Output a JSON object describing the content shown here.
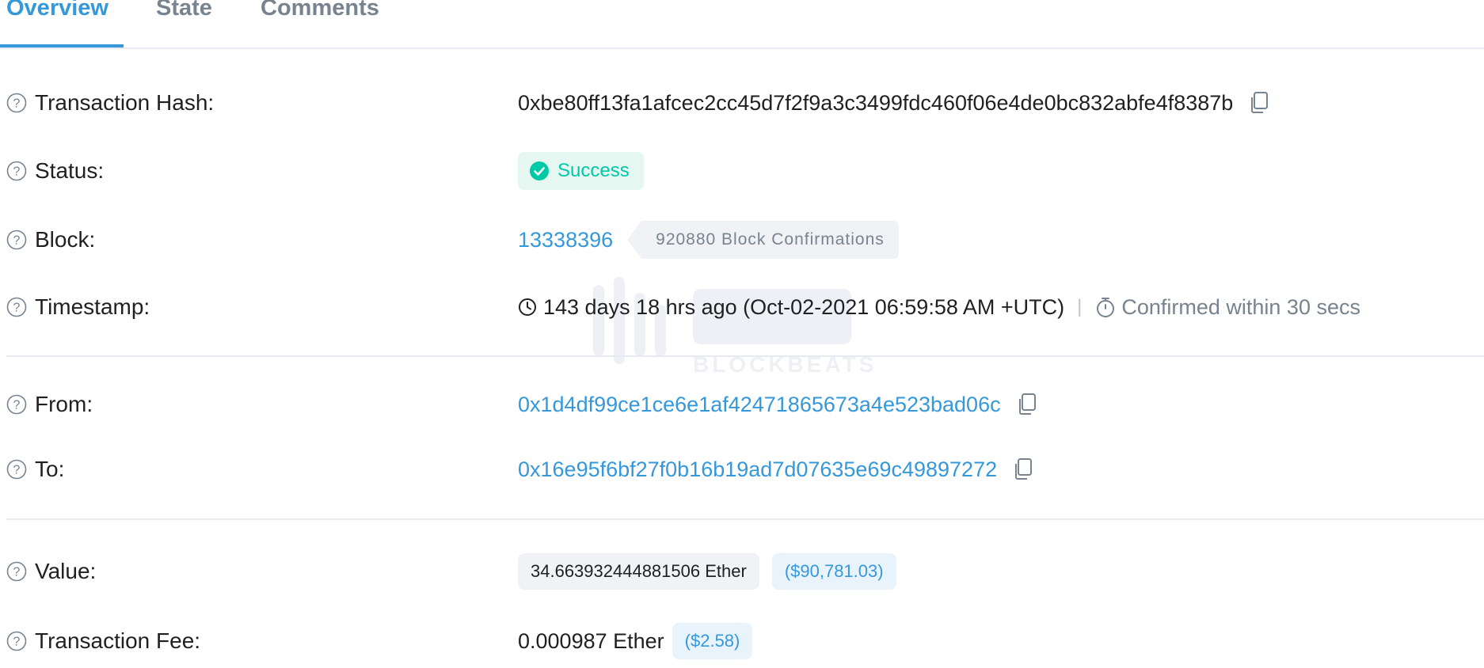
{
  "tabs": [
    {
      "label": "Overview",
      "active": true
    },
    {
      "label": "State",
      "active": false
    },
    {
      "label": "Comments",
      "active": false
    }
  ],
  "rows": {
    "hash": {
      "label": "Transaction Hash:",
      "value": "0xbe80ff13fa1afcec2cc45d7f2f9a3c3499fdc460f06e4de0bc832abfe4f8387b"
    },
    "status": {
      "label": "Status:",
      "value": "Success"
    },
    "block": {
      "label": "Block:",
      "number": "13338396",
      "confirmations": "920880 Block Confirmations"
    },
    "timestamp": {
      "label": "Timestamp:",
      "value": "143 days 18 hrs ago (Oct-02-2021 06:59:58 AM +UTC)",
      "separator": "|",
      "confirmed": "Confirmed within 30 secs"
    },
    "from": {
      "label": "From:",
      "value": "0x1d4df99ce1ce6e1af42471865673a4e523bad06c"
    },
    "to": {
      "label": "To:",
      "value": "0x16e95f6bf27f0b16b19ad7d07635e69c49897272"
    },
    "value": {
      "label": "Value:",
      "ether": "34.663932444881506 Ether",
      "usd": "($90,781.03)"
    },
    "fee": {
      "label": "Transaction Fee:",
      "ether": "0.000987 Ether",
      "usd": "($2.58)"
    }
  },
  "watermark": {
    "text": "BLOCKBEATS"
  },
  "colors": {
    "accent": "#3498db",
    "success": "#00c9a7",
    "success_bg": "#e6f7f1",
    "muted": "#77838f",
    "divider": "#e7eaf3"
  }
}
